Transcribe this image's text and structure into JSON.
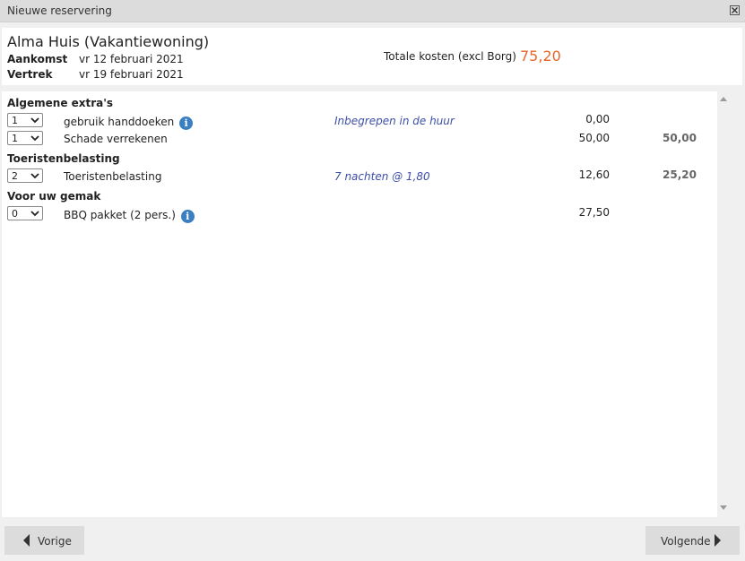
{
  "window": {
    "title": "Nieuwe reservering"
  },
  "header": {
    "property_name": "Alma Huis (Vakantiewoning)",
    "arrival_label": "Aankomst",
    "arrival_value": "vr 12 februari 2021",
    "departure_label": "Vertrek",
    "departure_value": "vr 19 februari 2021",
    "total_label": "Totale kosten (excl Borg)",
    "total_value": "75,20"
  },
  "sections": [
    {
      "title": "Algemene extra's",
      "items": [
        {
          "qty": "1",
          "label": "gebruik handdoeken",
          "info": true,
          "note": "Inbegrepen in de huur",
          "price": "0,00",
          "subtotal": ""
        },
        {
          "qty": "1",
          "label": "Schade verrekenen",
          "info": false,
          "note": "",
          "price": "50,00",
          "subtotal": "50,00"
        }
      ]
    },
    {
      "title": "Toeristenbelasting",
      "items": [
        {
          "qty": "2",
          "label": "Toeristenbelasting",
          "info": false,
          "note": "7 nachten @ 1,80",
          "price": "12,60",
          "subtotal": "25,20"
        }
      ]
    },
    {
      "title": "Voor uw gemak",
      "items": [
        {
          "qty": "0",
          "label": "BBQ pakket (2 pers.)",
          "info": true,
          "note": "",
          "price": "27,50",
          "subtotal": ""
        }
      ]
    }
  ],
  "buttons": {
    "prev_label": "Vorige",
    "next_label": "Volgende"
  },
  "icons": {
    "info": "info-icon",
    "close": "close-icon",
    "prev": "triangle-left-icon",
    "next": "triangle-right-icon"
  },
  "colors": {
    "total_accent": "#e8672a",
    "note_text": "#3d4fa8",
    "info_badge": "#3a7fc1"
  }
}
